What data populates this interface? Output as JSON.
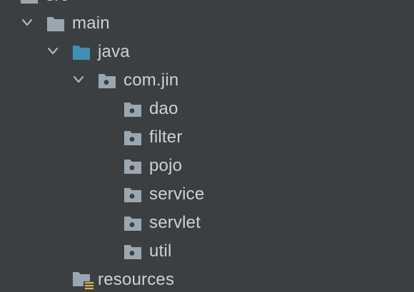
{
  "project_tree": {
    "top_partial": {
      "label": "src",
      "icon": "folder-icon",
      "expanded": true
    },
    "main": {
      "label": "main",
      "icon": "folder-icon",
      "expanded": true
    },
    "java": {
      "label": "java",
      "icon": "source-root-folder-icon",
      "expanded": true
    },
    "package": {
      "label": "com.jin",
      "icon": "package-icon",
      "expanded": true
    },
    "packages": [
      {
        "label": "dao",
        "icon": "package-icon"
      },
      {
        "label": "filter",
        "icon": "package-icon"
      },
      {
        "label": "pojo",
        "icon": "package-icon"
      },
      {
        "label": "service",
        "icon": "package-icon"
      },
      {
        "label": "servlet",
        "icon": "package-icon"
      },
      {
        "label": "util",
        "icon": "package-icon"
      }
    ],
    "resources": {
      "label": "resources",
      "icon": "resources-root-folder-icon"
    }
  },
  "colors": {
    "background": "#3c3f41",
    "text": "#cdd1d4",
    "folder_gray": "#9aa7b0",
    "source_root_blue": "#3d90b3",
    "resources_marker": "#e8b13a",
    "chevron": "#aeb3b7"
  }
}
